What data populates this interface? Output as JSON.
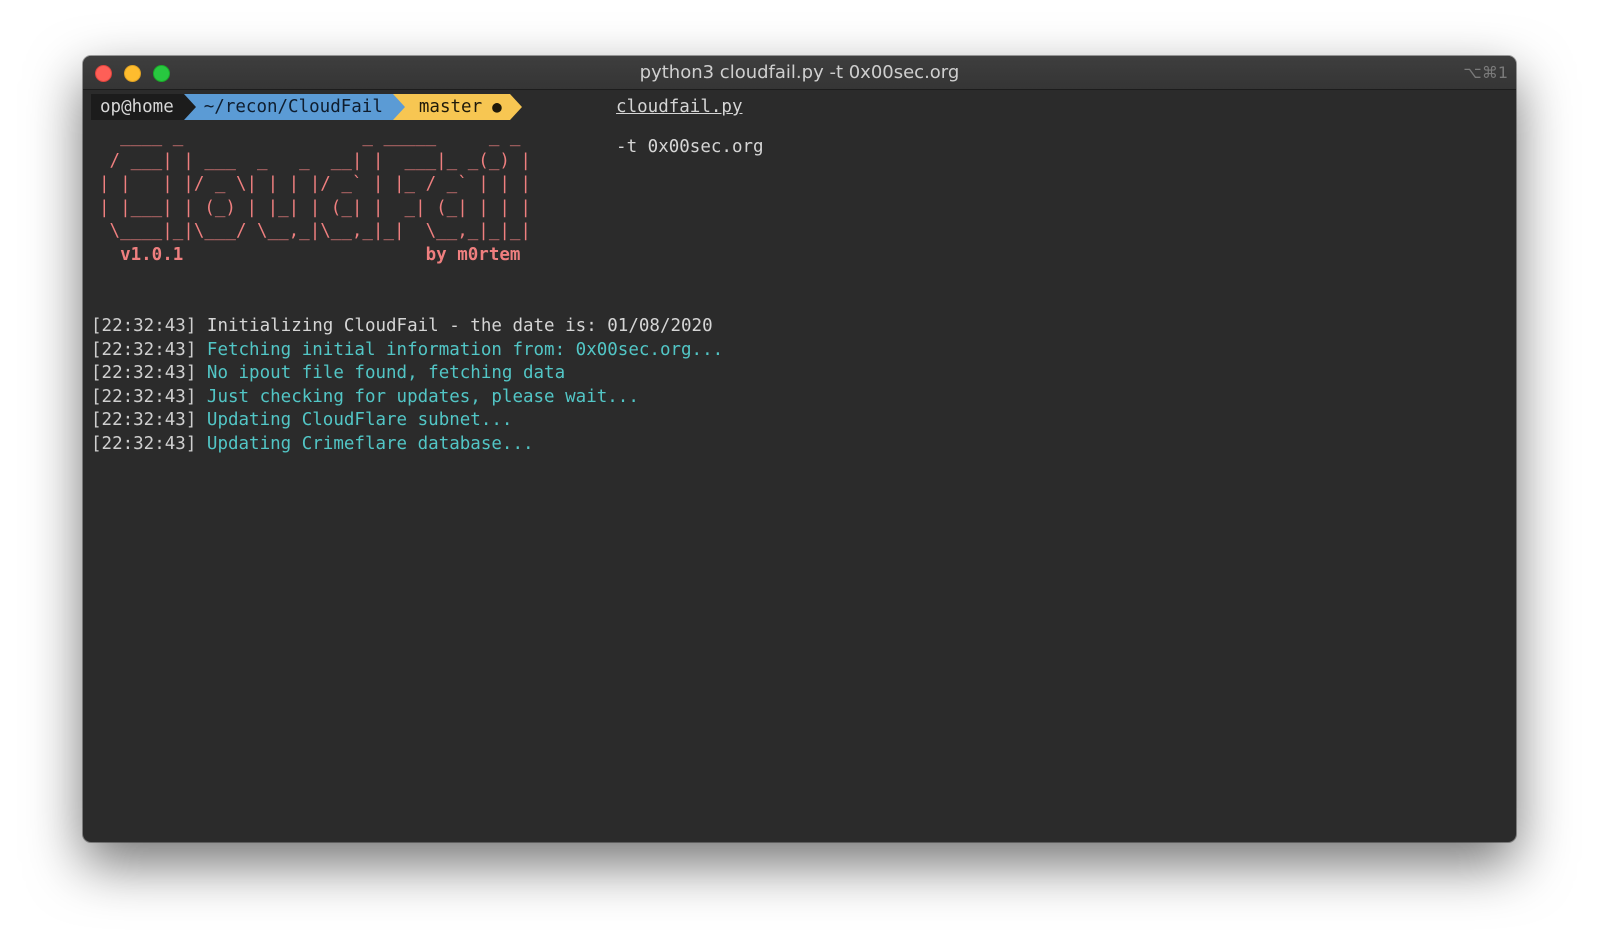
{
  "window": {
    "title": "python3 cloudfail.py -t 0x00sec.org",
    "shortcut": "⌥⌘1"
  },
  "prompt": {
    "user": "op@home",
    "dir": "~/recon/CloudFail",
    "branch_icon": "",
    "branch": "master",
    "dirty_indicator": "●",
    "command": "python3",
    "file": "cloudfail.py",
    "args": "-t 0x00sec.org"
  },
  "banner": {
    "ascii": "  ____ _                 _ _____     _ _\n / ___| | ___  _   _  __| |  ___|_ _(_) |\n| |   | |/ _ \\| | | |/ _` | |_ / _` | | |\n| |___| | (_) | |_| | (_| |  _| (_| | | |\n \\____|_|\\___/ \\__,_|\\__,_|_|  \\__,_|_|_|",
    "version": "v1.0.1",
    "author": "by m0rtem"
  },
  "log": [
    {
      "time": "[22:32:43]",
      "message": "Initializing CloudFail - the date is: 01/08/2020",
      "color": "white"
    },
    {
      "time": "[22:32:43]",
      "message": "Fetching initial information from: 0x00sec.org...",
      "color": "cyan"
    },
    {
      "time": "[22:32:43]",
      "message": "No ipout file found, fetching data",
      "color": "cyan"
    },
    {
      "time": "[22:32:43]",
      "message": "Just checking for updates, please wait...",
      "color": "cyan"
    },
    {
      "time": "[22:32:43]",
      "message": "Updating CloudFlare subnet...",
      "color": "cyan"
    },
    {
      "time": "[22:32:43]",
      "message": "Updating Crimeflare database...",
      "color": "cyan"
    }
  ],
  "colors": {
    "background": "#2b2b2b",
    "banner": "#ef7f7f",
    "cyan": "#52c6c6",
    "dir_segment": "#5b9bd5",
    "git_segment": "#f7c652"
  }
}
